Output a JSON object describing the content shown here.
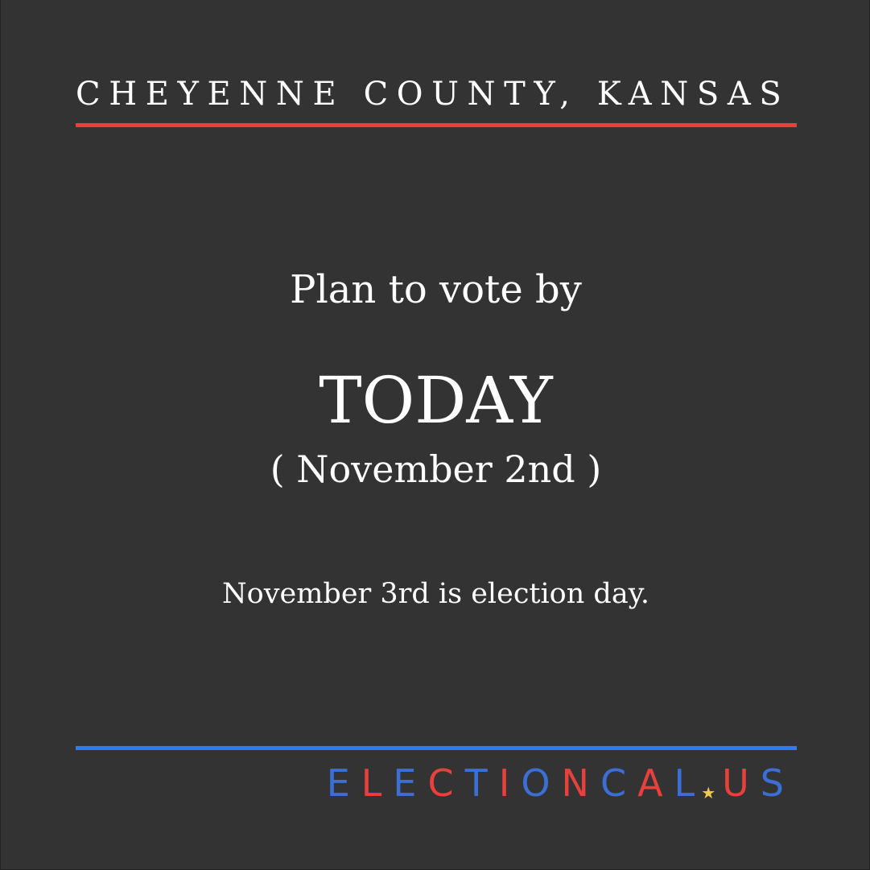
{
  "header": {
    "county": "CHEYENNE COUNTY, KANSAS"
  },
  "main": {
    "intro": "Plan to vote by",
    "deadline": "TODAY",
    "deadline_date": "( November 2nd )",
    "note": "November 3rd is election day."
  },
  "footer": {
    "brand_part1": "ELECTIONCAL",
    "brand_star": "★",
    "brand_part2": "US"
  },
  "colors": {
    "background": "#333333",
    "accent_red": "#e8403c",
    "accent_blue": "#2d7cf0",
    "star_yellow": "#f2c94c"
  }
}
